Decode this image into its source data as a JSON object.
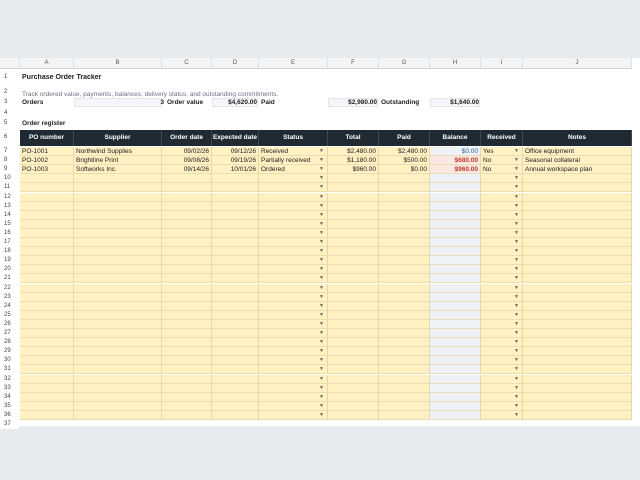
{
  "columns": [
    "A",
    "B",
    "C",
    "D",
    "E",
    "F",
    "G",
    "H",
    "I",
    "J"
  ],
  "title": "Purchase Order Tracker",
  "subtitle": "Track ordered value, payments, balances, delivery status, and outstanding commitments.",
  "summary": {
    "orders_label": "Orders",
    "orders_value": "3",
    "order_value_label": "Order value",
    "order_value": "$4,620.00",
    "paid_label": "Paid",
    "paid_value": "$2,980.00",
    "outstanding_label": "Outstanding",
    "outstanding_value": "$1,640.00"
  },
  "register_label": "Order register",
  "headers": [
    "PO number",
    "Supplier",
    "Order date",
    "Expected date",
    "Status",
    "Total",
    "Paid",
    "Balance",
    "Received",
    "Notes"
  ],
  "orders": [
    {
      "row": "7",
      "po": "PO-1001",
      "supplier": "Northwind Supplies",
      "order_date": "09/02/26",
      "expected": "09/12/26",
      "status": "Received",
      "total": "$2,480.00",
      "paid": "$2,480.00",
      "balance": "$0.00",
      "received": "Yes",
      "notes": "Office equipment"
    },
    {
      "row": "8",
      "po": "PO-1002",
      "supplier": "Brightline Print",
      "order_date": "09/08/26",
      "expected": "09/19/26",
      "status": "Partially received",
      "total": "$1,180.00",
      "paid": "$500.00",
      "balance": "$680.00",
      "received": "No",
      "notes": "Seasonal collateral"
    },
    {
      "row": "9",
      "po": "PO-1003",
      "supplier": "Softworks Inc.",
      "order_date": "09/14/26",
      "expected": "10/01/26",
      "status": "Ordered",
      "total": "$960.00",
      "paid": "$0.00",
      "balance": "$960.00",
      "received": "No",
      "notes": "Annual workspace plan"
    }
  ],
  "row_numbers": [
    "1",
    "2",
    "3",
    "4",
    "5",
    "6"
  ],
  "empty_rows": [
    "10",
    "11",
    "12",
    "13",
    "14",
    "15",
    "16",
    "17",
    "18",
    "19",
    "20",
    "21",
    "22",
    "23",
    "24",
    "25",
    "26",
    "27",
    "28",
    "29",
    "30",
    "31",
    "32",
    "33",
    "34",
    "35",
    "36"
  ],
  "last_row": "37",
  "dropdown_icon": "dropdown-arrow-icon"
}
